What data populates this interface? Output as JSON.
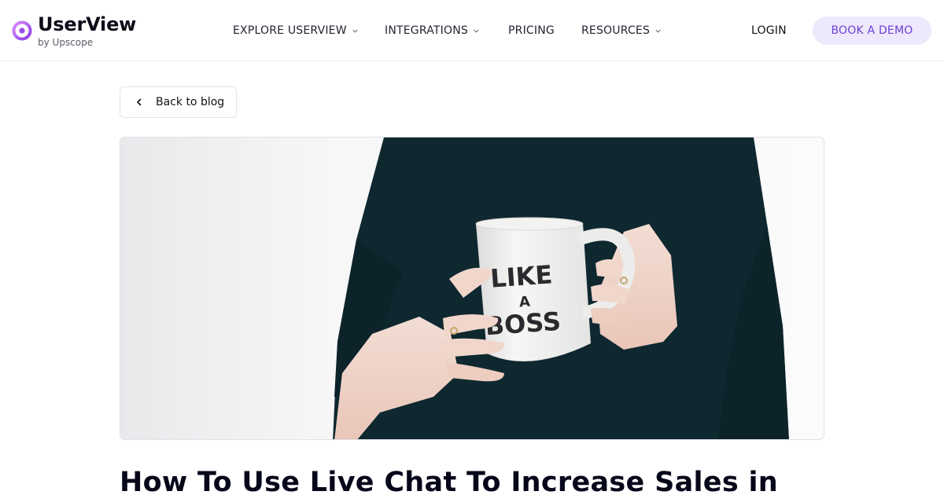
{
  "header": {
    "brand_name": "UserView",
    "brand_sub": "by Upscope",
    "nav": [
      {
        "label": "EXPLORE USERVIEW",
        "has_dropdown": true
      },
      {
        "label": "INTEGRATIONS",
        "has_dropdown": true
      },
      {
        "label": "PRICING",
        "has_dropdown": false
      },
      {
        "label": "RESOURCES",
        "has_dropdown": true
      }
    ],
    "login_label": "LOGIN",
    "demo_label": "BOOK A DEMO"
  },
  "back_label": "Back to blog",
  "hero": {
    "mug_line1": "LIKE",
    "mug_line2": "A",
    "mug_line3": "BOSS"
  },
  "article": {
    "title": "How To Use Live Chat To Increase Sales in"
  },
  "colors": {
    "accent": "#6d3fd8",
    "accent_bg": "#ede8fb",
    "logo_gradient_start": "#c77dff",
    "logo_gradient_end": "#8b3fdc"
  }
}
